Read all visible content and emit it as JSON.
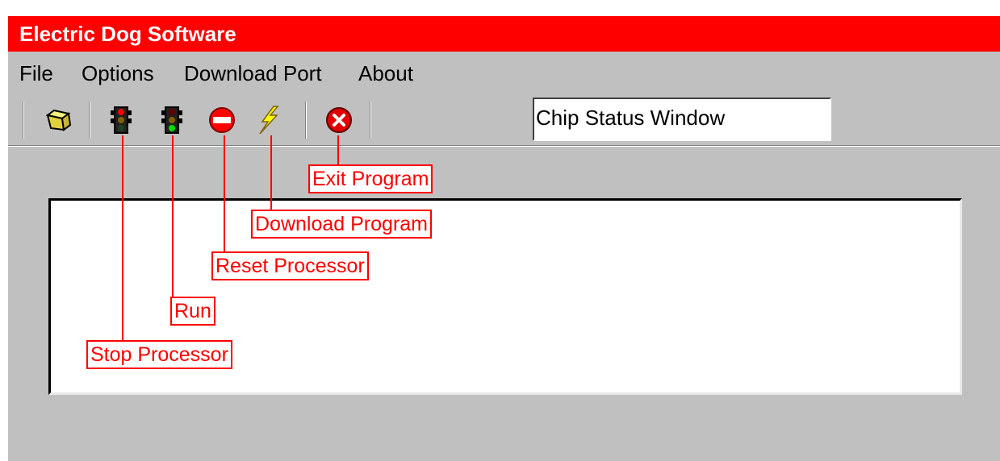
{
  "window": {
    "title": "Electric Dog Software",
    "title_bar_color": "#ff0000",
    "face_color": "#c0c0c0"
  },
  "menu": {
    "items": [
      "File",
      "Options",
      "Download Port",
      "About"
    ]
  },
  "toolbar": {
    "buttons": [
      {
        "icon": "open-folder-icon"
      },
      {
        "icon": "traffic-light-red-icon"
      },
      {
        "icon": "traffic-light-green-icon"
      },
      {
        "icon": "no-entry-icon"
      },
      {
        "icon": "lightning-bolt-icon"
      },
      {
        "icon": "red-x-circle-icon"
      }
    ],
    "status_box": "Chip Status Window"
  },
  "callouts": {
    "exit_program": "Exit Program",
    "download_program": "Download Program",
    "reset_processor": "Reset Processor",
    "run": "Run",
    "stop_processor": "Stop Processor",
    "color": "#ff0000"
  }
}
